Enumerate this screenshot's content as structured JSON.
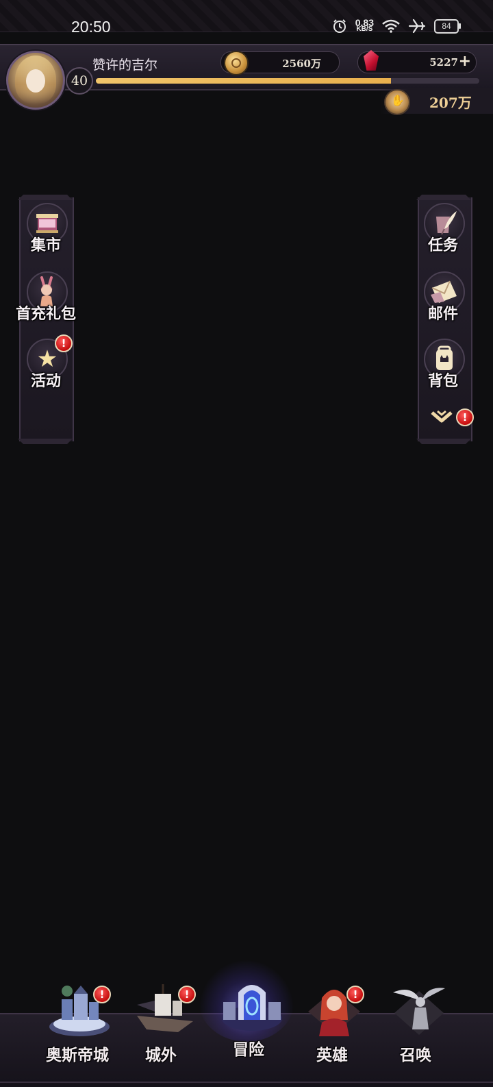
{
  "status_bar": {
    "time": "20:50",
    "net_speed": "0.83",
    "net_unit": "KB/S",
    "battery": "84"
  },
  "player": {
    "name": "赞许的吉尔",
    "level": "40",
    "xp_progress": 0.77
  },
  "currencies": {
    "gold": "2560万",
    "gems": "5227",
    "soul": "207万"
  },
  "left_menu": [
    {
      "label": "集市",
      "icon": "market-stall-icon",
      "badge": false
    },
    {
      "label": "首充礼包",
      "icon": "bunny-girl-icon",
      "badge": false
    },
    {
      "label": "活动",
      "icon": "star-icon",
      "badge": true
    }
  ],
  "right_menu": [
    {
      "label": "任务",
      "icon": "quill-scroll-icon",
      "badge": false
    },
    {
      "label": "邮件",
      "icon": "envelope-icon",
      "badge": false
    },
    {
      "label": "背包",
      "icon": "backpack-icon",
      "badge": false
    }
  ],
  "expand_badge": "!",
  "bottom_nav": [
    {
      "label": "奥斯帝城",
      "icon": "city-icon",
      "badge": true
    },
    {
      "label": "城外",
      "icon": "airship-icon",
      "badge": true
    },
    {
      "label": "冒险",
      "icon": "portal-icon",
      "badge": false,
      "active": true
    },
    {
      "label": "英雄",
      "icon": "hero-girl-icon",
      "badge": true
    },
    {
      "label": "召唤",
      "icon": "angel-statue-icon",
      "badge": false
    }
  ],
  "badge_text": "!",
  "colors": {
    "background": "#0e0e10",
    "panel": "#231e29",
    "gold_text": "#eecf96",
    "xp_bar": "#f0c46a",
    "badge_red": "#c50d0d"
  }
}
